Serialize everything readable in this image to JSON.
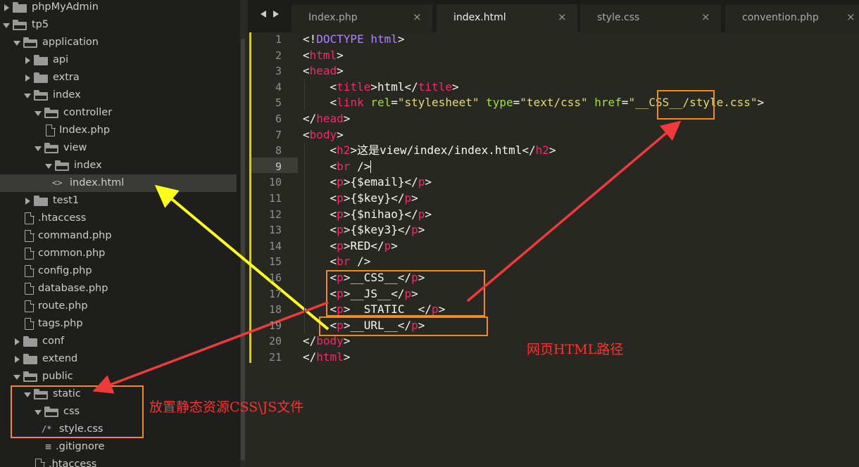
{
  "sidebar": {
    "items": [
      {
        "label": "phpMyAdmin",
        "kind": "folder",
        "expanded": false,
        "depth": 0
      },
      {
        "label": "tp5",
        "kind": "folder",
        "expanded": true,
        "depth": 0
      },
      {
        "label": "application",
        "kind": "folder",
        "expanded": true,
        "depth": 1
      },
      {
        "label": "api",
        "kind": "folder",
        "expanded": false,
        "depth": 2
      },
      {
        "label": "extra",
        "kind": "folder",
        "expanded": false,
        "depth": 2
      },
      {
        "label": "index",
        "kind": "folder",
        "expanded": true,
        "depth": 2
      },
      {
        "label": "controller",
        "kind": "folder",
        "expanded": true,
        "depth": 3
      },
      {
        "label": "Index.php",
        "kind": "file",
        "depth": 4
      },
      {
        "label": "view",
        "kind": "folder",
        "expanded": true,
        "depth": 3
      },
      {
        "label": "index",
        "kind": "folder",
        "expanded": true,
        "depth": 4
      },
      {
        "label": "index.html",
        "kind": "html",
        "depth": 5,
        "selected": true
      },
      {
        "label": "test1",
        "kind": "folder",
        "expanded": false,
        "depth": 2
      },
      {
        "label": ".htaccess",
        "kind": "file",
        "depth": 2
      },
      {
        "label": "command.php",
        "kind": "file",
        "depth": 2
      },
      {
        "label": "common.php",
        "kind": "file",
        "depth": 2
      },
      {
        "label": "config.php",
        "kind": "file",
        "depth": 2
      },
      {
        "label": "database.php",
        "kind": "file",
        "depth": 2
      },
      {
        "label": "route.php",
        "kind": "file",
        "depth": 2
      },
      {
        "label": "tags.php",
        "kind": "file",
        "depth": 2
      },
      {
        "label": "conf",
        "kind": "folder",
        "expanded": false,
        "depth": 1
      },
      {
        "label": "extend",
        "kind": "folder",
        "expanded": false,
        "depth": 1
      },
      {
        "label": "public",
        "kind": "folder",
        "expanded": true,
        "depth": 1
      },
      {
        "label": "static",
        "kind": "folder",
        "expanded": true,
        "depth": 2
      },
      {
        "label": "css",
        "kind": "folder",
        "expanded": true,
        "depth": 3
      },
      {
        "label": "style.css",
        "kind": "css",
        "depth": 4
      },
      {
        "label": ".gitignore",
        "kind": "text",
        "depth": 3
      },
      {
        "label": ".htaccess",
        "kind": "file",
        "depth": 3
      }
    ]
  },
  "tabs": [
    {
      "label": "Index.php",
      "active": false
    },
    {
      "label": "index.html",
      "active": true
    },
    {
      "label": "style.css",
      "active": false
    },
    {
      "label": "convention.php",
      "active": false
    }
  ],
  "tab_close_glyph": "×",
  "editor": {
    "current_line": 9,
    "lines": [
      {
        "num": "1",
        "tokens": [
          [
            "p",
            "<!"
          ],
          [
            "kw",
            "DOCTYPE"
          ],
          [
            "p",
            " "
          ],
          [
            "kw",
            "html"
          ],
          [
            "p",
            ">"
          ]
        ]
      },
      {
        "num": "2",
        "tokens": [
          [
            "p",
            "<"
          ],
          [
            "tg",
            "html"
          ],
          [
            "p",
            ">"
          ]
        ]
      },
      {
        "num": "3",
        "tokens": [
          [
            "p",
            "<"
          ],
          [
            "tg",
            "head"
          ],
          [
            "p",
            ">"
          ]
        ]
      },
      {
        "num": "4",
        "tokens": [
          [
            "p",
            "    <"
          ],
          [
            "tg",
            "title"
          ],
          [
            "p",
            ">html</"
          ],
          [
            "tg",
            "title"
          ],
          [
            "p",
            ">"
          ]
        ]
      },
      {
        "num": "5",
        "tokens": [
          [
            "p",
            "    <"
          ],
          [
            "tg",
            "link"
          ],
          [
            "p",
            " "
          ],
          [
            "at",
            "rel"
          ],
          [
            "p",
            "="
          ],
          [
            "st",
            "\"stylesheet\""
          ],
          [
            "p",
            " "
          ],
          [
            "at",
            "type"
          ],
          [
            "p",
            "="
          ],
          [
            "st",
            "\"text/css\""
          ],
          [
            "p",
            " "
          ],
          [
            "at",
            "href"
          ],
          [
            "p",
            "="
          ],
          [
            "st",
            "\"__CSS__/style.css\""
          ],
          [
            "p",
            ">"
          ]
        ]
      },
      {
        "num": "6",
        "tokens": [
          [
            "p",
            "</"
          ],
          [
            "tg",
            "head"
          ],
          [
            "p",
            ">"
          ]
        ]
      },
      {
        "num": "7",
        "tokens": [
          [
            "p",
            "<"
          ],
          [
            "tg",
            "body"
          ],
          [
            "p",
            ">"
          ]
        ]
      },
      {
        "num": "8",
        "tokens": [
          [
            "p",
            "    <"
          ],
          [
            "tg",
            "h2"
          ],
          [
            "p",
            ">这是view/index/index.html</"
          ],
          [
            "tg",
            "h2"
          ],
          [
            "p",
            ">"
          ]
        ]
      },
      {
        "num": "9",
        "tokens": [
          [
            "p",
            "    <"
          ],
          [
            "tg",
            "br"
          ],
          [
            "p",
            " />"
          ]
        ],
        "cursor": true
      },
      {
        "num": "10",
        "tokens": [
          [
            "p",
            "    <"
          ],
          [
            "tg",
            "p"
          ],
          [
            "p",
            ">{$email}</"
          ],
          [
            "tg",
            "p"
          ],
          [
            "p",
            ">"
          ]
        ]
      },
      {
        "num": "11",
        "tokens": [
          [
            "p",
            "    <"
          ],
          [
            "tg",
            "p"
          ],
          [
            "p",
            ">{$key}</"
          ],
          [
            "tg",
            "p"
          ],
          [
            "p",
            ">"
          ]
        ]
      },
      {
        "num": "12",
        "tokens": [
          [
            "p",
            "    <"
          ],
          [
            "tg",
            "p"
          ],
          [
            "p",
            ">{$nihao}</"
          ],
          [
            "tg",
            "p"
          ],
          [
            "p",
            ">"
          ]
        ]
      },
      {
        "num": "13",
        "tokens": [
          [
            "p",
            "    <"
          ],
          [
            "tg",
            "p"
          ],
          [
            "p",
            ">{$key3}</"
          ],
          [
            "tg",
            "p"
          ],
          [
            "p",
            ">"
          ]
        ]
      },
      {
        "num": "14",
        "tokens": [
          [
            "p",
            "    <"
          ],
          [
            "tg",
            "p"
          ],
          [
            "p",
            ">RED</"
          ],
          [
            "tg",
            "p"
          ],
          [
            "p",
            ">"
          ]
        ]
      },
      {
        "num": "15",
        "tokens": [
          [
            "p",
            "    <"
          ],
          [
            "tg",
            "br"
          ],
          [
            "p",
            " />"
          ]
        ]
      },
      {
        "num": "16",
        "tokens": [
          [
            "p",
            "    <"
          ],
          [
            "tg",
            "p"
          ],
          [
            "p",
            ">__CSS__</"
          ],
          [
            "tg",
            "p"
          ],
          [
            "p",
            ">"
          ]
        ]
      },
      {
        "num": "17",
        "tokens": [
          [
            "p",
            "    <"
          ],
          [
            "tg",
            "p"
          ],
          [
            "p",
            ">__JS__</"
          ],
          [
            "tg",
            "p"
          ],
          [
            "p",
            ">"
          ]
        ]
      },
      {
        "num": "18",
        "tokens": [
          [
            "p",
            "    <"
          ],
          [
            "tg",
            "p"
          ],
          [
            "p",
            ">__STATIC__</"
          ],
          [
            "tg",
            "p"
          ],
          [
            "p",
            ">"
          ]
        ]
      },
      {
        "num": "19",
        "tokens": [
          [
            "p",
            "    <"
          ],
          [
            "tg",
            "p"
          ],
          [
            "p",
            ">__URL__</"
          ],
          [
            "tg",
            "p"
          ],
          [
            "p",
            ">"
          ]
        ]
      },
      {
        "num": "20",
        "tokens": [
          [
            "p",
            "</"
          ],
          [
            "tg",
            "body"
          ],
          [
            "p",
            ">"
          ]
        ]
      },
      {
        "num": "21",
        "tokens": [
          [
            "p",
            "</"
          ],
          [
            "tg",
            "html"
          ],
          [
            "p",
            ">"
          ]
        ]
      }
    ]
  },
  "annotations": {
    "web_path_label": "网页HTML路径",
    "static_path_label": "放置静态资源CSS\\JS文件"
  },
  "colors": {
    "tag": "#f92672",
    "attribute": "#a6e22e",
    "string": "#e6db74",
    "keyword": "#ae81ff",
    "annotation_box": "#f08a24",
    "arrow_yellow": "#ffff1a",
    "arrow_red": "#f03a3a",
    "annotation_text": "#ff3030"
  }
}
